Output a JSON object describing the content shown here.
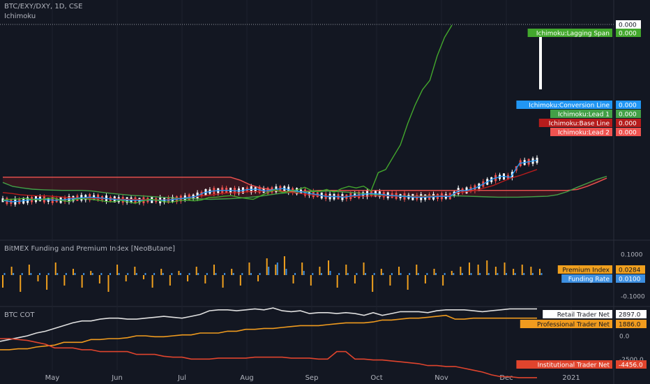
{
  "header": {
    "symbol": "BTC/EXY/DXY, 1D, CSE",
    "indicator": "Ichimoku"
  },
  "panes": {
    "funding_title": "BitMEX Funding and Premium Index [NeoButane]",
    "cot_title": "BTC COT"
  },
  "colors": {
    "background": "#131722",
    "grid": "#1e222d",
    "text": "#b2b5be",
    "lagging": "#43a82d",
    "conversion": "#2196f3",
    "lead1": "#43a047",
    "base": "#b71c1c",
    "lead2": "#ef5350",
    "premium": "#f0a01e",
    "funding": "#3d8fe0",
    "retail": "#e0e0e0",
    "professional": "#f09b1e",
    "institutional": "#e0442d",
    "candle_up": "#ffffff",
    "candle_down": "#ef5350"
  },
  "chart_data": [
    {
      "type": "line",
      "name": "ichimoku",
      "x_axis_labels": [
        "May",
        "Jun",
        "Jul",
        "Aug",
        "Sep",
        "Oct",
        "Nov",
        "Dec",
        "2021"
      ],
      "series": [
        {
          "name": "Ichimoku:Lagging Span",
          "value_label": "0.000"
        },
        {
          "name": "Ichimoku:Conversion Line",
          "value_label": "0.000"
        },
        {
          "name": "Ichimoku:Lead 1",
          "value_label": "0.000"
        },
        {
          "name": "Ichimoku:Base Line",
          "value_label": "0.000"
        },
        {
          "name": "Ichimoku:Lead 2",
          "value_label": "0.000"
        }
      ],
      "last_price_label": "0.000",
      "lagging_span": [
        0.3,
        0.33,
        0.34,
        0.36,
        0.33,
        0.31,
        0.36,
        0.37,
        0.29,
        0.26,
        0.34,
        0.35,
        0.33,
        0.3,
        0.26,
        0.25,
        0.3,
        0.25,
        0.2,
        0.28,
        0.33,
        0.3,
        0.25,
        0.24,
        0.29,
        0.3,
        0.28,
        0.31,
        0.39,
        0.4,
        0.43,
        0.45,
        0.4,
        0.36,
        0.33,
        0.44,
        0.56,
        0.64,
        0.55,
        0.6,
        0.64,
        0.72,
        0.61,
        0.59,
        0.65,
        0.56,
        0.68,
        0.75,
        0.7,
        0.76,
        0.6,
        1.2,
        1.3,
        1.7,
        2.1,
        2.8,
        3.4,
        3.9,
        4.2,
        5.0,
        5.6,
        6.0
      ],
      "conversion_line": [
        0.3,
        0.25,
        0.27,
        0.31,
        0.35,
        0.32,
        0.3,
        0.32,
        0.35,
        0.38,
        0.4,
        0.38,
        0.35,
        0.32,
        0.31,
        0.3,
        0.3,
        0.31,
        0.3,
        0.31,
        0.34,
        0.38,
        0.42,
        0.55,
        0.6,
        0.62,
        0.62,
        0.6,
        0.65,
        0.66,
        0.6,
        0.65,
        0.68,
        0.62,
        0.58,
        0.52,
        0.48,
        0.42,
        0.42,
        0.4,
        0.45,
        0.48,
        0.52,
        0.5,
        0.46,
        0.44,
        0.42,
        0.4,
        0.4,
        0.41,
        0.43,
        0.42,
        0.6,
        0.62,
        0.7,
        0.85,
        1.0,
        1.08,
        1.05,
        1.5,
        1.55,
        1.6
      ],
      "base_line": [
        0.55,
        0.52,
        0.48,
        0.46,
        0.44,
        0.44,
        0.42,
        0.4,
        0.38,
        0.36,
        0.36,
        0.35,
        0.35,
        0.34,
        0.33,
        0.33,
        0.32,
        0.32,
        0.31,
        0.32,
        0.35,
        0.38,
        0.42,
        0.45,
        0.48,
        0.52,
        0.54,
        0.55,
        0.58,
        0.58,
        0.6,
        0.62,
        0.58,
        0.55,
        0.52,
        0.48,
        0.46,
        0.44,
        0.42,
        0.42,
        0.42,
        0.43,
        0.44,
        0.44,
        0.44,
        0.43,
        0.42,
        0.42,
        0.42,
        0.43,
        0.44,
        0.45,
        0.55,
        0.58,
        0.62,
        0.7,
        0.78,
        0.9,
        1.02,
        1.1,
        1.2,
        1.3
      ],
      "lead1": [
        0.88,
        0.75,
        0.7,
        0.66,
        0.64,
        0.63,
        0.62,
        0.62,
        0.62,
        0.6,
        0.56,
        0.52,
        0.49,
        0.46,
        0.44,
        0.42,
        0.4,
        0.38,
        0.36,
        0.35,
        0.34,
        0.33,
        0.34,
        0.35,
        0.37,
        0.4,
        0.43,
        0.48,
        0.52,
        0.55,
        0.57,
        0.58,
        0.59,
        0.6,
        0.58,
        0.56,
        0.53,
        0.5,
        0.48,
        0.46,
        0.44,
        0.43,
        0.43,
        0.44,
        0.44,
        0.44,
        0.44,
        0.43,
        0.42,
        0.41,
        0.4,
        0.4,
        0.4,
        0.41,
        0.42,
        0.43,
        0.48,
        0.58,
        0.72,
        0.85,
        0.98,
        1.08
      ],
      "lead2": [
        1.05,
        1.05,
        1.05,
        1.05,
        1.05,
        1.05,
        1.05,
        1.05,
        1.05,
        1.05,
        1.05,
        1.05,
        1.05,
        1.05,
        1.05,
        1.05,
        1.05,
        1.05,
        1.05,
        1.05,
        1.05,
        1.05,
        1.05,
        1.05,
        0.95,
        0.8,
        0.7,
        0.65,
        0.6,
        0.58,
        0.58,
        0.6,
        0.62,
        0.62,
        0.62,
        0.62,
        0.62,
        0.62,
        0.62,
        0.62,
        0.62,
        0.62,
        0.62,
        0.62,
        0.62,
        0.62,
        0.62,
        0.62,
        0.62,
        0.62,
        0.62,
        0.62,
        0.62,
        0.62,
        0.62,
        0.62,
        0.62,
        0.62,
        0.65,
        0.75,
        0.88,
        1.02
      ]
    },
    {
      "type": "bar",
      "name": "funding",
      "title": "BitMEX Funding and Premium Index [NeoButane]",
      "y_ticks": [
        "0.1000",
        "-0.1000"
      ],
      "series": [
        {
          "name": "Premium Index",
          "value_label": "0.0284"
        },
        {
          "name": "Funding Rate",
          "value_label": "0.0100"
        }
      ],
      "premium_index": [
        -0.06,
        0.04,
        -0.08,
        0.05,
        -0.03,
        -0.07,
        0.06,
        -0.05,
        0.03,
        -0.06,
        0.02,
        -0.04,
        -0.08,
        0.05,
        -0.03,
        0.04,
        -0.02,
        -0.06,
        0.03,
        -0.05,
        0.02,
        -0.03,
        0.04,
        -0.04,
        0.05,
        -0.06,
        0.03,
        -0.05,
        0.06,
        -0.03,
        0.08,
        0.05,
        0.09,
        -0.04,
        0.06,
        -0.05,
        0.04,
        0.07,
        -0.06,
        0.05,
        -0.04,
        0.06,
        -0.08,
        0.03,
        -0.05,
        0.04,
        -0.07,
        0.05,
        -0.04,
        0.03,
        -0.05,
        0.02,
        0.04,
        0.06,
        0.05,
        0.07,
        0.04,
        0.06,
        0.03,
        0.05,
        0.04,
        0.03
      ],
      "funding_rate": [
        0.01,
        0.01,
        0.01,
        0.01,
        0.01,
        0.01,
        0.01,
        0.01,
        0.01,
        0.01,
        0.01,
        0.01,
        0.01,
        0.01,
        0.01,
        0.01,
        0.01,
        0.01,
        0.01,
        0.01,
        0.01,
        0.01,
        0.01,
        0.01,
        0.01,
        0.01,
        0.01,
        0.01,
        0.01,
        0.01,
        0.04,
        0.06,
        0.03,
        0.01,
        0.02,
        0.01,
        0.01,
        0.02,
        0.01,
        0.01,
        0.01,
        0.01,
        0.01,
        0.01,
        0.01,
        0.01,
        0.01,
        0.01,
        0.01,
        0.01,
        0.01,
        0.01,
        0.01,
        0.01,
        0.01,
        0.01,
        0.01,
        0.01,
        0.01,
        0.01,
        0.01,
        0.01
      ]
    },
    {
      "type": "line",
      "name": "cot",
      "title": "BTC COT",
      "y_ticks": [
        "0.0",
        "-2500.0"
      ],
      "series": [
        {
          "name": "Retail Trader Net",
          "value_label": "2897.0",
          "values": [
            -600,
            -400,
            -200,
            0,
            300,
            500,
            800,
            1100,
            1400,
            1600,
            1600,
            1800,
            1900,
            1900,
            1800,
            1800,
            1900,
            2000,
            2100,
            2000,
            1900,
            2100,
            2300,
            2700,
            2800,
            2800,
            2700,
            2800,
            2900,
            2800,
            3000,
            2700,
            2600,
            2700,
            2400,
            2500,
            2500,
            2400,
            2500,
            2400,
            2200,
            2500,
            2200,
            2400,
            2600,
            2600,
            2600,
            2500,
            2700,
            2800,
            2800,
            2800,
            2700,
            2600,
            2700,
            2800,
            2900,
            2900,
            2900,
            2900
          ]
        },
        {
          "name": "Professional Trader Net",
          "value_label": "1886.0",
          "values": [
            -1500,
            -1500,
            -1400,
            -1400,
            -1200,
            -1100,
            -1000,
            -700,
            -700,
            -700,
            -400,
            -400,
            -300,
            -300,
            -200,
            0,
            0,
            -100,
            -100,
            0,
            100,
            100,
            300,
            300,
            300,
            500,
            500,
            700,
            700,
            800,
            800,
            900,
            1000,
            1100,
            1100,
            1100,
            1200,
            1300,
            1400,
            1400,
            1400,
            1500,
            1700,
            1700,
            1800,
            1900,
            1900,
            2000,
            2100,
            2200,
            1800,
            1800,
            1900,
            1900,
            1900,
            1900,
            1900,
            1900,
            1900,
            1900
          ]
        },
        {
          "name": "Institutional Trader Net",
          "value_label": "-4456.0",
          "values": [
            -300,
            -300,
            -400,
            -500,
            -700,
            -900,
            -1300,
            -1300,
            -1300,
            -1500,
            -1500,
            -1700,
            -1700,
            -1700,
            -1700,
            -2000,
            -2000,
            -2000,
            -2200,
            -2300,
            -2300,
            -2500,
            -2500,
            -2500,
            -2400,
            -2400,
            -2400,
            -2400,
            -2300,
            -2300,
            -2300,
            -2300,
            -2400,
            -2400,
            -2400,
            -2500,
            -2500,
            -1700,
            -1700,
            -2500,
            -2500,
            -2600,
            -2600,
            -2700,
            -2800,
            -2900,
            -3000,
            -3200,
            -3200,
            -3300,
            -3300,
            -3500,
            -3700,
            -3900,
            -4200,
            -4400,
            -4400,
            -4500,
            -4500,
            -4500
          ]
        }
      ]
    }
  ]
}
